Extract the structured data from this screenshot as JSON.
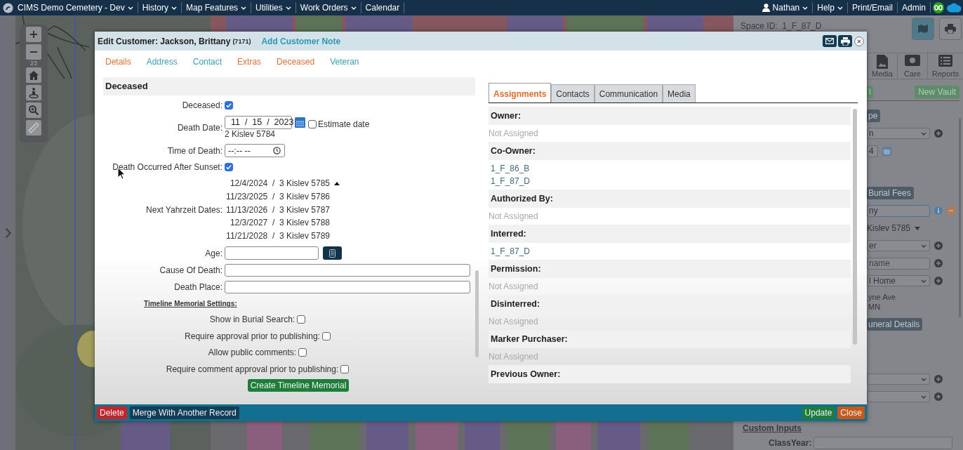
{
  "navbar": {
    "menus": [
      {
        "label": "CIMS Demo Cemetery - Dev",
        "dropdown": true
      },
      {
        "label": "History",
        "dropdown": true
      },
      {
        "label": "Map Features",
        "dropdown": true
      },
      {
        "label": "Utilities",
        "dropdown": true
      },
      {
        "label": "Work Orders",
        "dropdown": true
      },
      {
        "label": "Calendar",
        "dropdown": false
      }
    ],
    "user_menus": [
      {
        "label": "Nathan",
        "kind": "user",
        "dropdown": true
      },
      {
        "label": "Help",
        "kind": "menu",
        "dropdown": true
      },
      {
        "label": "Print/Email",
        "kind": "menu",
        "dropdown": false
      },
      {
        "label": "Admin",
        "kind": "menu",
        "dropdown": false
      }
    ]
  },
  "map": {
    "zoom_level": "23"
  },
  "side_panel": {
    "space_id": "Space ID:  1_F_87_D",
    "tabs": [
      {
        "label": "Media",
        "kind": "media"
      },
      {
        "label": "Care",
        "kind": "care"
      },
      {
        "label": "Reports",
        "kind": "reports"
      }
    ],
    "actions": [
      {
        "label": "l"
      },
      {
        "label": "New Vault"
      }
    ],
    "groups": [
      [
        {
          "kind": "button",
          "text": "pe"
        },
        {
          "kind": "select",
          "text": "n"
        },
        {
          "kind": "date",
          "text": "4"
        }
      ],
      [
        {
          "kind": "button",
          "text": "Burial Fees"
        },
        {
          "kind": "info-field",
          "text": "ny"
        },
        {
          "kind": "dropdown-text",
          "text": "Kislev 5785"
        },
        {
          "kind": "select",
          "text": "er"
        },
        {
          "kind": "input",
          "placeholder": "name"
        },
        {
          "kind": "select",
          "text": "l Home"
        },
        {
          "kind": "address",
          "lines": [
            "yne Ave",
            "MN"
          ]
        },
        {
          "kind": "button",
          "text": "uneral Details"
        }
      ],
      [
        {
          "kind": "select"
        },
        {
          "kind": "select"
        }
      ]
    ],
    "custom_inputs": {
      "title": "Custom Inputs",
      "fields": [
        {
          "label": "ClassYear:"
        }
      ]
    }
  },
  "dialog": {
    "title": "Edit Customer: Jackson, Brittany",
    "record_id": "(7171)",
    "note_link": "Add Customer Note",
    "section_links": [
      {
        "label": "Details",
        "color": "#e4703a"
      },
      {
        "label": "Address",
        "color": "#3a9fb8"
      },
      {
        "label": "Contact",
        "color": "#3a9fb8"
      },
      {
        "label": "Extras",
        "color": "#e4703a"
      },
      {
        "label": "Deceased",
        "color": "#e4703a"
      },
      {
        "label": "Veteran",
        "color": "#3a9fb8"
      }
    ],
    "section_title": "Deceased",
    "fields": [
      {
        "kind": "checkbox",
        "label": "Deceased:",
        "checked": true
      },
      {
        "kind": "date",
        "label": "Death Date:",
        "value": "11  /  15  /  2023",
        "note": "2 Kislev 5784",
        "estimate": {
          "label": "Estimate date",
          "checked": false
        }
      },
      {
        "kind": "time",
        "label": "Time of Death:",
        "value": "--:-- --"
      },
      {
        "kind": "checkbox",
        "label": "Death Occurred After Sunset:",
        "checked": true
      },
      {
        "kind": "dates",
        "label": "Next Yahrzeit Dates:",
        "expanded": true,
        "lines": [
          "12/4/2024  /  3 Kislev 5785",
          "11/23/2025  /  3 Kislev 5786",
          "11/13/2026  /  3 Kislev 5787",
          "12/3/2027  /  3 Kislev 5788",
          "11/21/2028  /  3 Kislev 5789"
        ]
      },
      {
        "kind": "calc",
        "label": "Age:"
      },
      {
        "kind": "text",
        "label": "Cause Of Death:"
      },
      {
        "kind": "text",
        "label": "Death Place:"
      }
    ],
    "timeline": {
      "title": "Timeline Memorial Settings:",
      "options": [
        {
          "label": "Show in Burial Search:",
          "checked": false
        },
        {
          "label": "Require approval prior to publishing:",
          "checked": false
        },
        {
          "label": "Allow public comments:",
          "checked": false
        },
        {
          "label": "Require comment approval prior to publishing:",
          "checked": false
        }
      ],
      "button": "Create Timeline Memorial"
    },
    "tabs": [
      {
        "label": "Assignments",
        "selected": true
      },
      {
        "label": "Contacts",
        "selected": false
      },
      {
        "label": "Communication",
        "selected": false
      },
      {
        "label": "Media",
        "selected": false
      }
    ],
    "assignments": [
      {
        "heading": "Owner:",
        "entries": [
          {
            "text": "Not Assigned",
            "kind": "empty"
          }
        ]
      },
      {
        "heading": "Co-Owner:",
        "entries": [
          {
            "text": "1_F_86_B",
            "kind": "space"
          },
          {
            "text": "1_F_87_D",
            "kind": "space"
          }
        ]
      },
      {
        "heading": "Authorized By:",
        "entries": [
          {
            "text": "Not Assigned",
            "kind": "empty"
          }
        ]
      },
      {
        "heading": "Interred:",
        "entries": [
          {
            "text": "1_F_87_D",
            "kind": "space"
          }
        ]
      },
      {
        "heading": "Permission:",
        "entries": [
          {
            "text": "Not Assigned",
            "kind": "empty"
          }
        ]
      },
      {
        "heading": "Disinterred:",
        "entries": [
          {
            "text": "Not Assigned",
            "kind": "empty"
          }
        ]
      },
      {
        "heading": "Marker Purchaser:",
        "entries": [
          {
            "text": "Not Assigned",
            "kind": "empty"
          }
        ]
      },
      {
        "heading": "Previous Owner:"
      }
    ],
    "footer_left": [
      {
        "label": "Delete",
        "kind": "danger"
      },
      {
        "label": "Merge With Another Record",
        "kind": "dark"
      }
    ],
    "footer_right": [
      {
        "label": "Update",
        "kind": "success"
      },
      {
        "label": "Close",
        "kind": "warning"
      }
    ]
  }
}
